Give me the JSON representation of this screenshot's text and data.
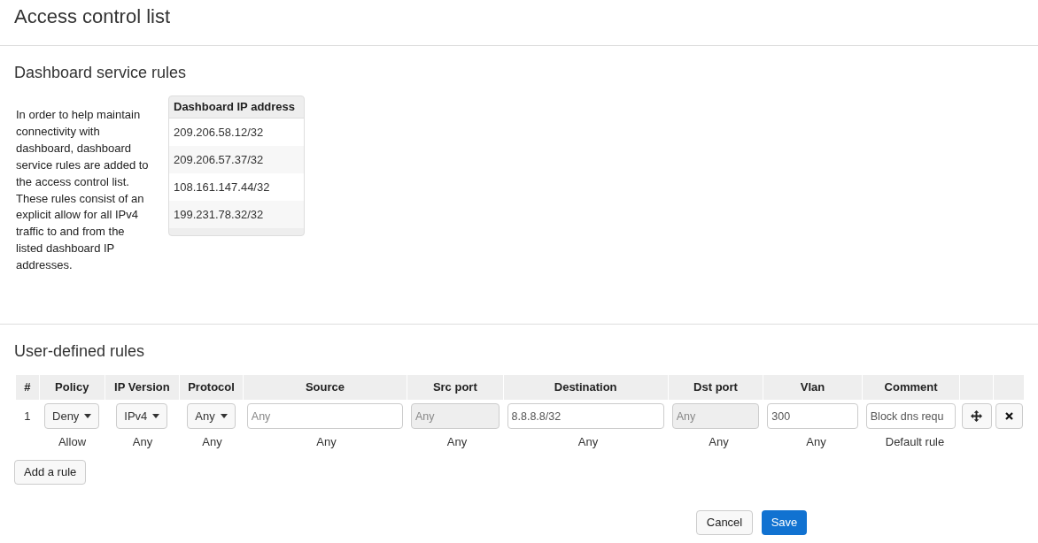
{
  "page_title": "Access control list",
  "dashboard_rules": {
    "title": "Dashboard service rules",
    "description": "In order to help maintain connectivity with dashboard, dashboard service rules are added to the access control list. These rules consist of an explicit allow for all IPv4 traffic to and from the listed dashboard IP addresses.",
    "table": {
      "column": "Dashboard IP address",
      "rows": [
        "209.206.58.12/32",
        "209.206.57.37/32",
        "108.161.147.44/32",
        "199.231.78.32/32"
      ]
    }
  },
  "user_rules": {
    "title": "User-defined rules",
    "columns": [
      "#",
      "Policy",
      "IP Version",
      "Protocol",
      "Source",
      "Src port",
      "Destination",
      "Dst port",
      "Vlan",
      "Comment"
    ],
    "rows": [
      {
        "cells": [
          {
            "kind": "number",
            "text": "1"
          },
          {
            "kind": "dropdown",
            "value": "Deny"
          },
          {
            "kind": "dropdown",
            "value": "IPv4"
          },
          {
            "kind": "dropdown",
            "value": "Any"
          },
          {
            "kind": "input",
            "placeholder": "Any",
            "disabled": false
          },
          {
            "kind": "input",
            "placeholder": "Any",
            "disabled": true
          },
          {
            "kind": "input",
            "value": "8.8.8.8/32",
            "disabled": false
          },
          {
            "kind": "input",
            "placeholder": "Any",
            "disabled": true
          },
          {
            "kind": "input",
            "value": "300",
            "disabled": false
          },
          {
            "kind": "input",
            "value": "Block dns requ",
            "disabled": false
          },
          {
            "kind": "move"
          },
          {
            "kind": "delete"
          }
        ]
      }
    ],
    "default_rule": [
      "Allow",
      "Any",
      "Any",
      "Any",
      "Any",
      "Any",
      "Any",
      "Any",
      "Default rule"
    ],
    "add_button": "Add a rule"
  },
  "buttons": {
    "cancel": "Cancel",
    "save": "Save"
  }
}
